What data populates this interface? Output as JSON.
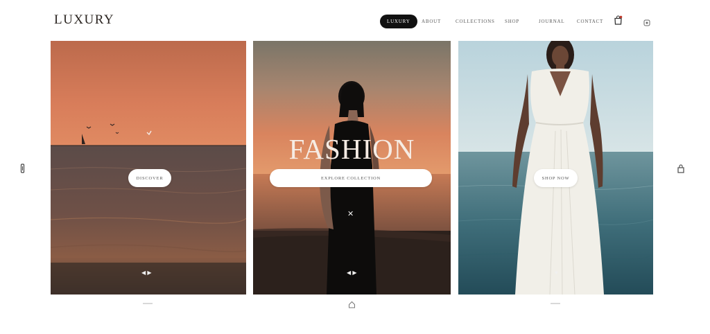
{
  "brand": {
    "logo": "LUXURY"
  },
  "nav": {
    "items": [
      {
        "label": "LUXURY",
        "active": true
      },
      {
        "label": "ABOUT",
        "active": false
      },
      {
        "label": "COLLECTIONS",
        "active": false
      },
      {
        "label": "SHOP",
        "active": false
      },
      {
        "label": "JOURNAL",
        "active": false
      },
      {
        "label": "CONTACT",
        "active": false
      }
    ]
  },
  "header_icons": [
    "shopping-bag-icon",
    "account-icon"
  ],
  "side_arrows": [
    "prev-arrow-icon",
    "next-arrow-icon"
  ],
  "panels": [
    {
      "cta": "DISCOVER",
      "bottom_glyph": "◀ ▶"
    },
    {
      "title": "FASHION",
      "cta": "EXPLORE COLLECTION",
      "center_glyph": "✕",
      "bottom_glyph": "◀ ▶"
    },
    {
      "cta": "SHOP NOW",
      "bottom_glyph": "♥"
    }
  ],
  "colors": {
    "active_nav_bg": "#111111",
    "sunset_sky": "#c06a4a",
    "sea_teal": "#3f6e7a",
    "dress_white": "#f1efe8"
  }
}
